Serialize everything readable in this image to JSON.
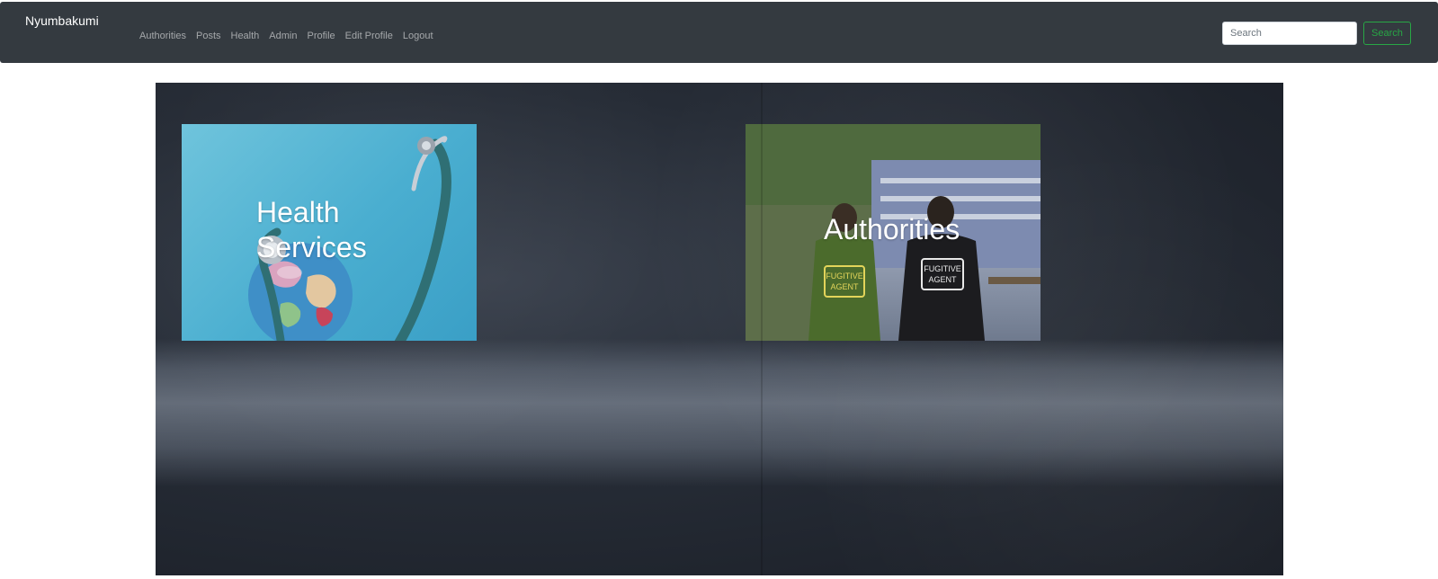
{
  "brand": "Nyumbakumi",
  "nav": {
    "items": [
      {
        "label": "Authorities"
      },
      {
        "label": "Posts"
      },
      {
        "label": "Health"
      },
      {
        "label": "Admin"
      },
      {
        "label": "Profile"
      },
      {
        "label": "Edit Profile"
      },
      {
        "label": "Logout"
      }
    ]
  },
  "search": {
    "placeholder": "Search",
    "button_label": "Search"
  },
  "cards": [
    {
      "title": "Health Services",
      "image": "stethoscope-globe-image"
    },
    {
      "title": "Authorities",
      "image": "fugitive-agents-image"
    }
  ],
  "colors": {
    "navbar_bg": "#343a40",
    "nav_link": "#9a9da0",
    "search_button": "#28a745"
  }
}
